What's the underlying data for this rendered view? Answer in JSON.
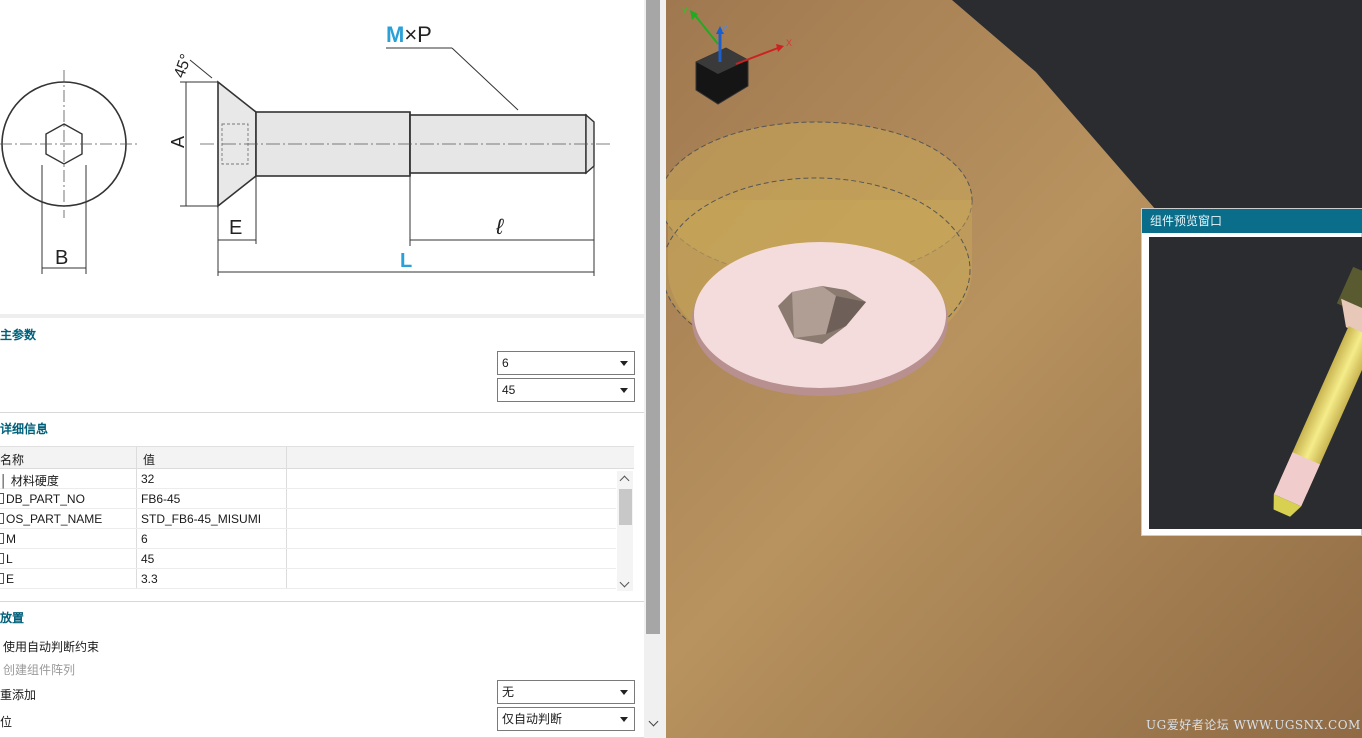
{
  "drawing": {
    "label_mxp_m": "M",
    "label_mxp_rest": "×P",
    "label_45": "45°",
    "label_A": "A",
    "label_E": "E",
    "label_B": "B",
    "label_l": "ℓ",
    "label_L": "L"
  },
  "main_params": {
    "title": "主参数",
    "dropdown_1": "6",
    "dropdown_2": "45"
  },
  "details": {
    "title": "详细信息",
    "col_name": "名称",
    "col_value": "值",
    "rows": [
      {
        "name": "材料硬度",
        "value": "32"
      },
      {
        "name": "DB_PART_NO",
        "value": "FB6-45"
      },
      {
        "name": "OS_PART_NAME",
        "value": "STD_FB6-45_MISUMI"
      },
      {
        "name": "M",
        "value": "6"
      },
      {
        "name": "L",
        "value": "45"
      },
      {
        "name": "E",
        "value": "3.3"
      }
    ]
  },
  "placement": {
    "title": "放置",
    "opt_auto_constraint": "使用自动判断约束",
    "opt_create_array": "创建组件阵列",
    "label_repeat_add": "重添加",
    "dropdown_repeat": "无",
    "label_position": "位",
    "dropdown_position": "仅自动判断"
  },
  "viewport": {
    "preview_title": "组件预览窗口",
    "watermark": "UG爱好者论坛 WWW.UGSNX.COM",
    "axis_x": "X",
    "axis_y": "Y",
    "axis_z": "Z"
  },
  "colors": {
    "section_title": "#00607a",
    "preview_title_bar": "#0a6d8a",
    "part_brown": "#b08a5e",
    "background_dark": "#2a2c30",
    "screw_yellow": "#f0e68c"
  }
}
